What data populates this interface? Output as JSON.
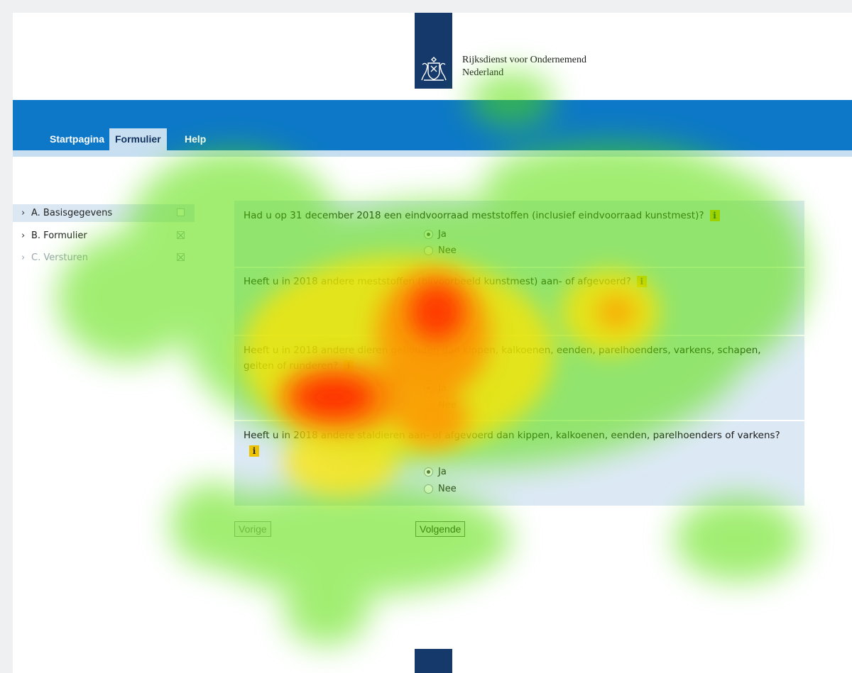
{
  "header": {
    "org_line1": "Rijksdienst voor Ondernemend",
    "org_line2": "Nederland"
  },
  "nav": {
    "tabs": [
      {
        "label": "Startpagina",
        "active": false
      },
      {
        "label": "Formulier",
        "active": true
      },
      {
        "label": "Help",
        "active": false
      }
    ]
  },
  "sidebar": {
    "items": [
      {
        "label": "A. Basisgegevens",
        "checkbox": "empty",
        "selected": true
      },
      {
        "label": "B. Formulier",
        "checkbox": "crossed",
        "selected": false
      },
      {
        "label": "C. Versturen",
        "checkbox": "crossed",
        "selected": false
      }
    ]
  },
  "questions": [
    {
      "text": "Had u op 31 december 2018 een eindvoorraad meststoffen (inclusief eindvoorraad kunstmest)?",
      "info": "i",
      "options": [
        {
          "label": "Ja",
          "selected": true
        },
        {
          "label": "Nee",
          "selected": false
        }
      ]
    },
    {
      "text": "Heeft u in 2018 andere meststoffen (bijvoorbeeld kunstmest) aan- of afgevoerd?",
      "info": "i",
      "options": [
        {
          "label": "Ja",
          "selected": true
        },
        {
          "label": "Nee",
          "selected": false
        }
      ]
    },
    {
      "text": "Heeft u in 2018 andere dieren gehouden dan kippen, kalkoenen, eenden, parelhoenders, varkens, schapen, geiten of runderen?",
      "info": "i",
      "options": [
        {
          "label": "Ja",
          "selected": true
        },
        {
          "label": "Nee",
          "selected": false
        }
      ]
    },
    {
      "text": "Heeft u in 2018 andere staldieren aan- of afgevoerd dan kippen, kalkoenen, eenden, parelhoenders of varkens?",
      "info": "i",
      "options": [
        {
          "label": "Ja",
          "selected": true
        },
        {
          "label": "Nee",
          "selected": false
        }
      ]
    }
  ],
  "buttons": {
    "prev_label": "Vorige",
    "next_label": "Volgende"
  },
  "colors": {
    "brand_dark": "#15396b",
    "nav_blue": "#0d78c7",
    "panel_bg": "#dce9f5",
    "info_badge": "#f2c200"
  }
}
